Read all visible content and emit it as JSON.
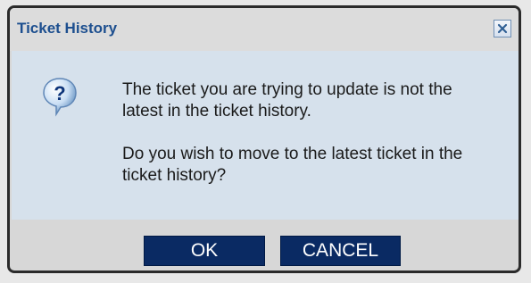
{
  "dialog": {
    "title": "Ticket History",
    "close_icon": "close-icon",
    "help_icon": "question-help-icon",
    "message": [
      "The ticket you are trying to update is not the latest in the ticket history.",
      "Do you wish to move to the latest ticket in the ticket history?"
    ],
    "buttons": {
      "ok_label": "OK",
      "cancel_label": "CANCEL"
    }
  },
  "colors": {
    "title_text": "#1d4f8f",
    "content_background": "#d6e1ec",
    "button_background": "#0a2a63",
    "button_text": "#ffffff"
  }
}
